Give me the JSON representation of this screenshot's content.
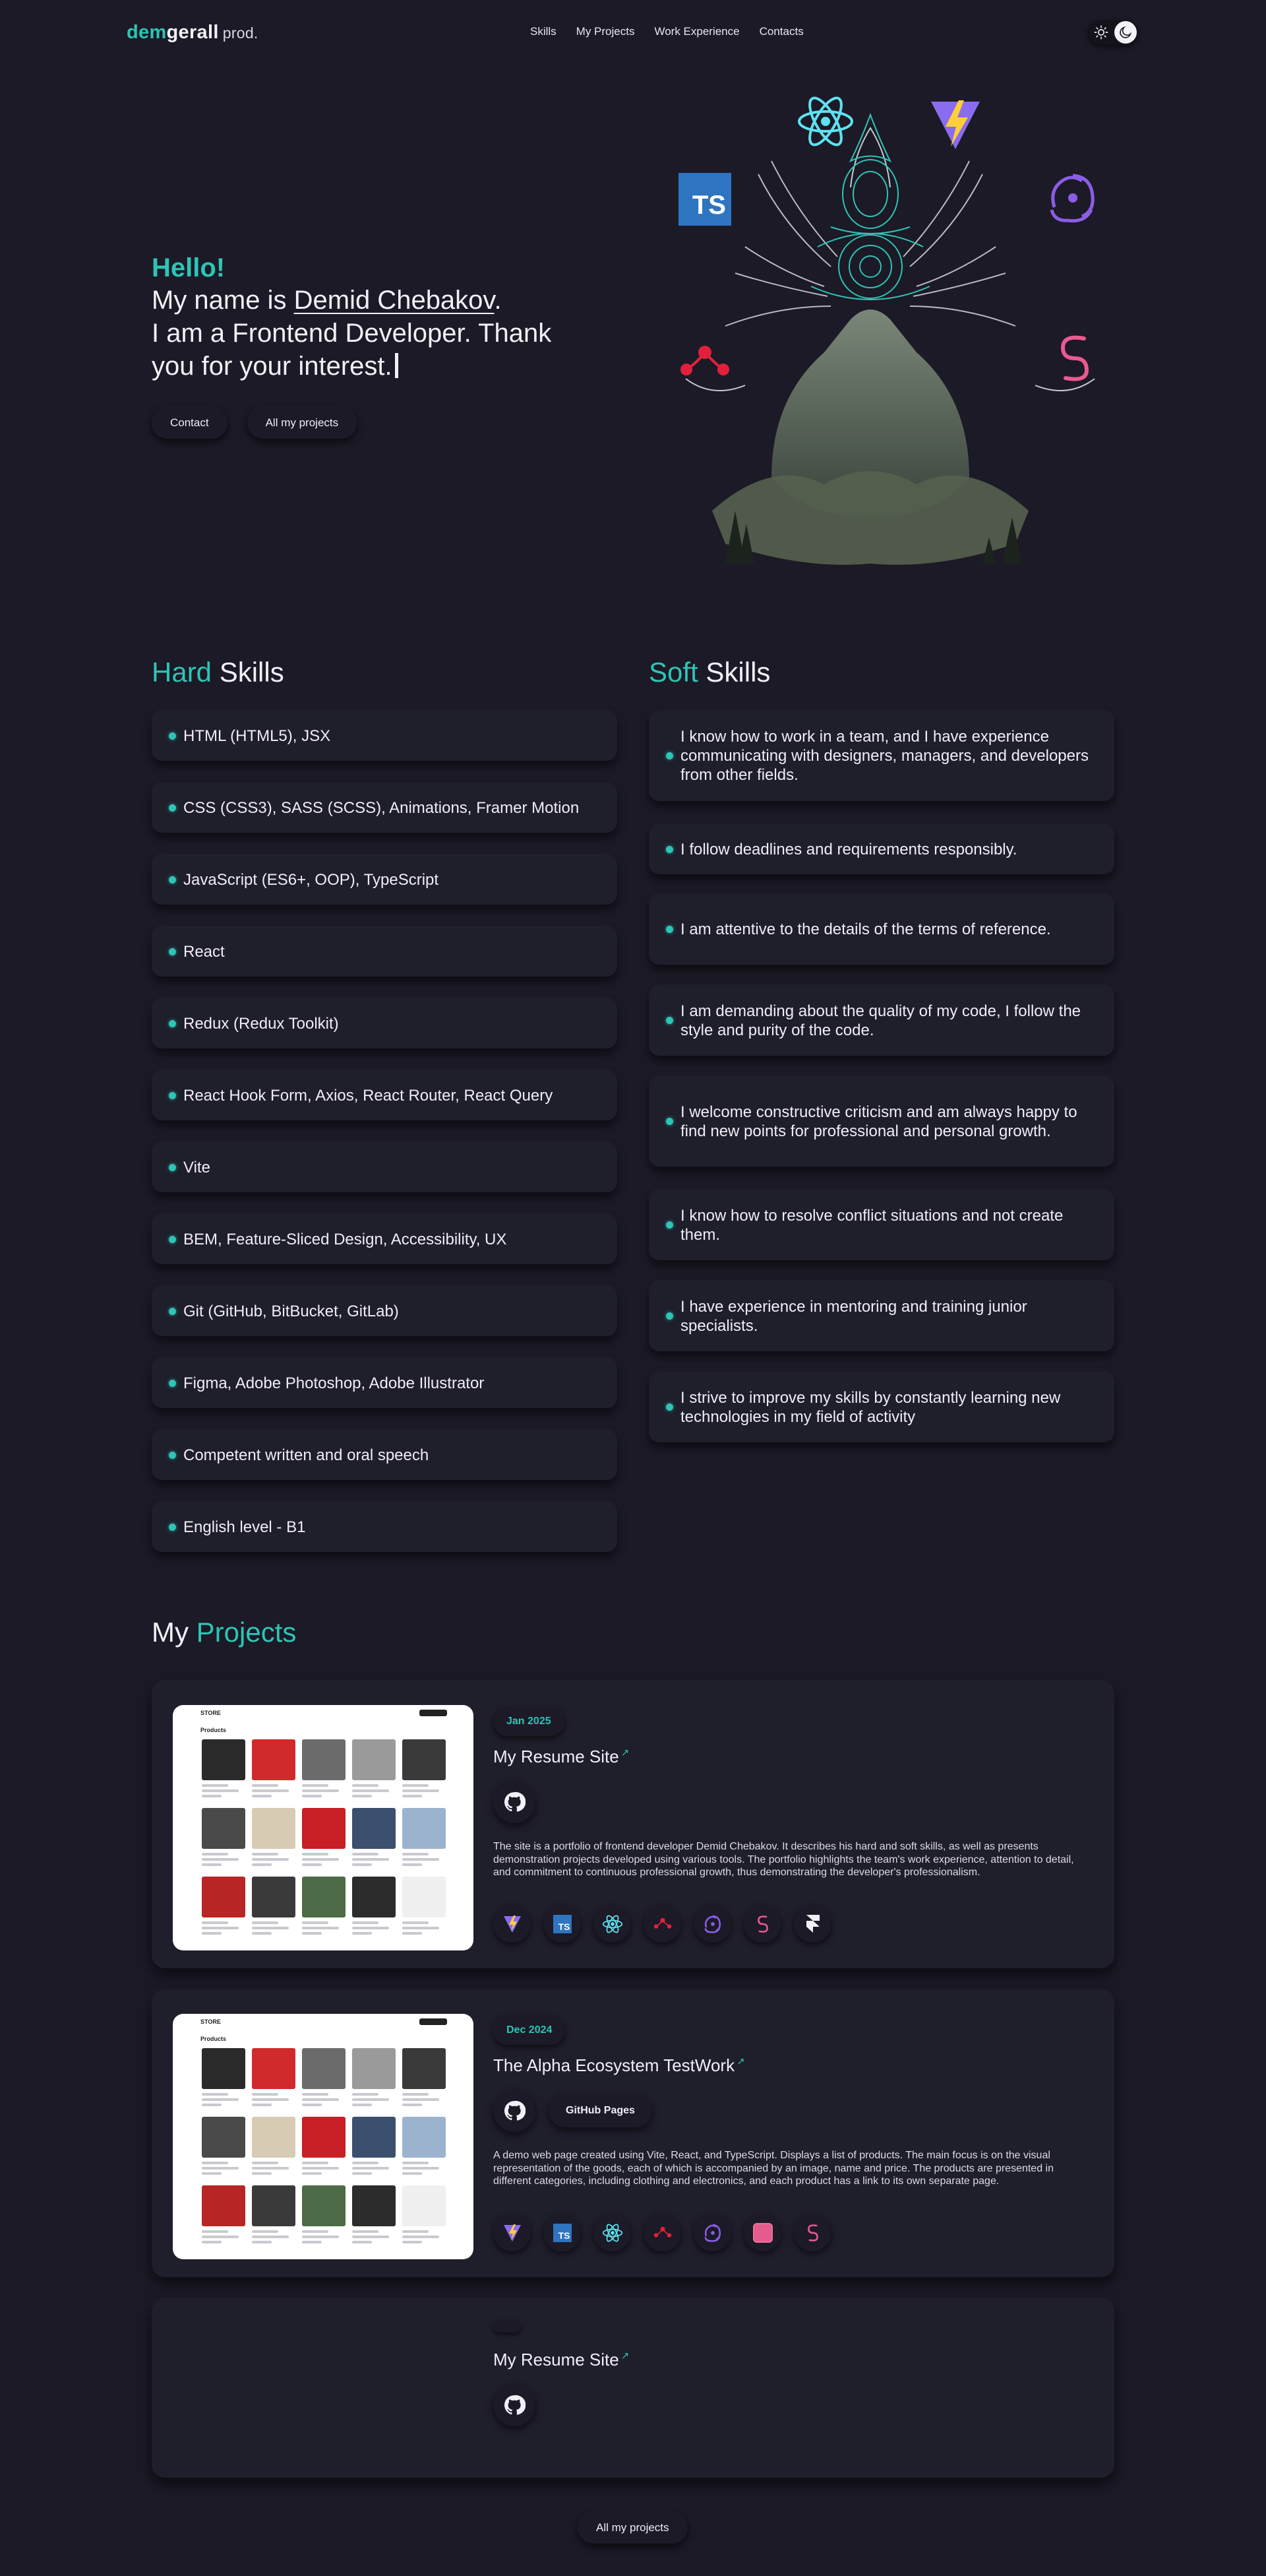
{
  "header": {
    "logo_part1": "dem",
    "logo_part2": "gerall",
    "logo_part3": "prod.",
    "nav": [
      "Skills",
      "My Projects",
      "Work Experience",
      "Contacts"
    ]
  },
  "hero": {
    "hello": "Hello!",
    "line1_prefix": "My name is ",
    "line1_name": "Demid Chebakov",
    "line1_suffix": ".",
    "line2": "I am a Frontend Developer. Thank",
    "line3": "you for your interest.",
    "buttons": [
      "Contact",
      "All my projects"
    ],
    "art_icons": [
      "react-icon",
      "vite-icon",
      "typescript-icon",
      "redux-icon",
      "react-router-icon",
      "react-hook-form-icon"
    ]
  },
  "skills": {
    "hard_accent": "Hard",
    "hard_rest": " Skills",
    "soft_accent": "Soft",
    "soft_rest": " Skills",
    "hard": [
      "HTML (HTML5), JSX",
      "CSS (CSS3), SASS (SCSS), Animations, Framer Motion",
      "JavaScript (ES6+, OOP), TypeScript",
      "React",
      "Redux (Redux Toolkit)",
      "React Hook Form, Axios, React Router, React Query",
      "Vite",
      "BEM, Feature-Sliced Design, Accessibility, UX",
      "Git (GitHub, BitBucket, GitLab)",
      "Figma, Adobe Photoshop, Adobe Illustrator",
      "Competent written and oral speech",
      "English level - B1"
    ],
    "soft": [
      "I know how to work in a team, and I have experience communicating with designers, managers, and developers from other fields.",
      "I follow deadlines and requirements responsibly.",
      "I am attentive to the details of the terms of reference.",
      "I am demanding about the quality of my code, I follow the style and purity of the code.",
      "I welcome constructive criticism and am always happy to find new points for professional and personal growth.",
      "I know how to resolve conflict situations and not create them.",
      "I have experience in mentoring and training junior specialists.",
      "I strive to improve my skills by constantly learning new technologies in my field of activity"
    ]
  },
  "projects": {
    "title_rest": "My ",
    "title_accent": "Projects",
    "items": [
      {
        "date": "Jan 2025",
        "title": "My Resume Site",
        "desc": "The site is a portfolio of frontend developer Demid Chebakov. It describes his hard and soft skills, as well as presents demonstration projects developed using various tools. The portfolio highlights the team's work experience, attention to detail, and commitment to continuous professional growth, thus demonstrating the developer's professionalism.",
        "tech": [
          "vite-icon",
          "typescript-icon",
          "react-icon",
          "react-router-icon",
          "redux-icon",
          "react-hook-form-icon",
          "framer-motion-icon"
        ]
      },
      {
        "date": "Dec 2024",
        "title": "The Alpha Ecosystem TestWork",
        "pages_label": "GitHub Pages",
        "desc": "A demo web page created using Vite, React, and TypeScript. Displays a list of products. The main focus is on the visual representation of the goods, each of which is accompanied by an image, name and price. The products are presented in different categories, including clothing and electronics, and each product has a link to its own separate page.",
        "tech": [
          "vite-icon",
          "typescript-icon",
          "react-icon",
          "react-router-icon",
          "redux-icon",
          "zustand-icon",
          "react-hook-form-icon"
        ]
      },
      {
        "title": "My Resume Site"
      }
    ],
    "all_button": "All my projects",
    "mock": {
      "brand": "STORE",
      "products": "Products"
    }
  },
  "colors": {
    "accent": "#2ec4b6",
    "background": "#1b1a26",
    "card": "#1f1e2b"
  }
}
